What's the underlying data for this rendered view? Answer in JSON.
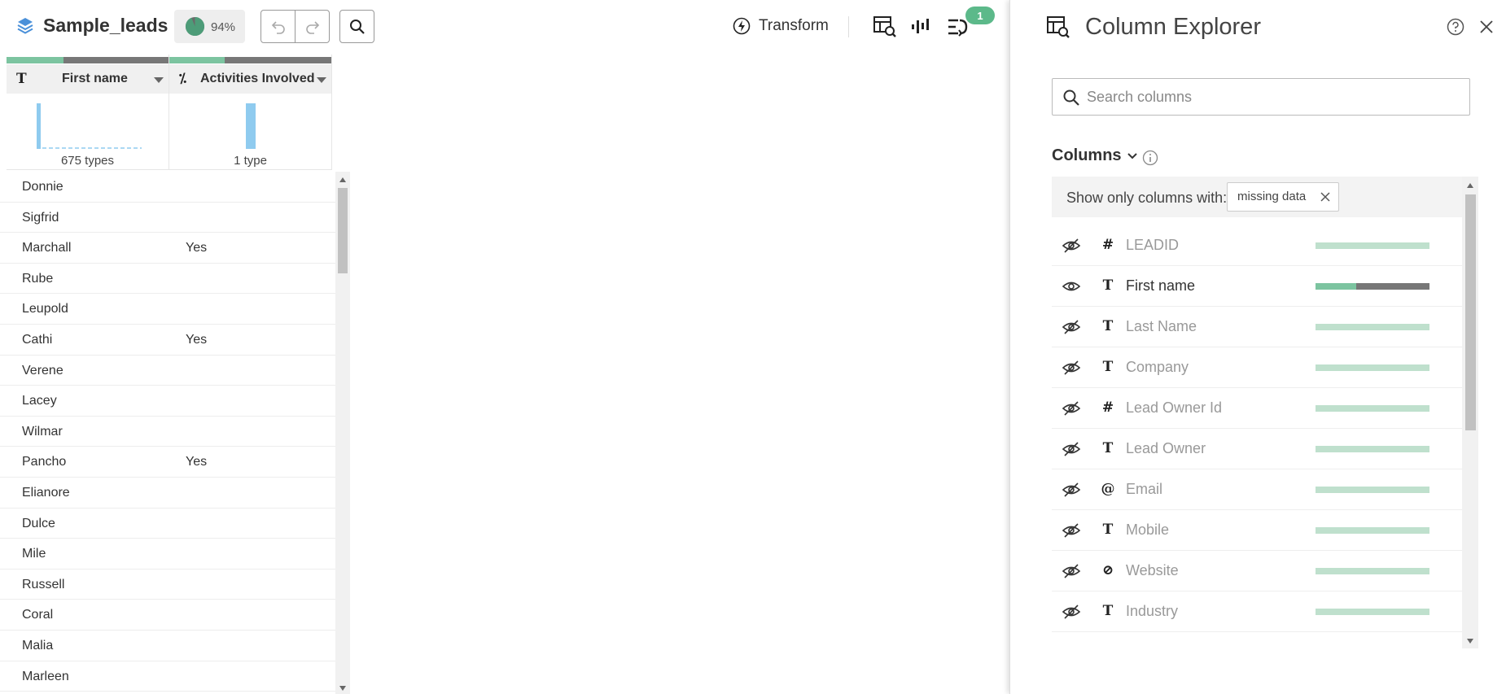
{
  "toolbar": {
    "dataset_name": "Sample_leads",
    "quality_percent": 94,
    "quality_label": "94%",
    "transform_label": "Transform",
    "notification_count": "1"
  },
  "grid": {
    "columns": [
      {
        "type_glyph": "T",
        "name": "First name",
        "types_summary": "675 types",
        "valid_fraction": 0.35,
        "missing_fraction": 0.65
      },
      {
        "type_glyph": "⁒",
        "name": "Activities Involved",
        "types_summary": "1 type",
        "valid_fraction": 0.34,
        "missing_fraction": 0.66
      }
    ],
    "rows": [
      [
        "Donnie",
        ""
      ],
      [
        "Sigfrid",
        ""
      ],
      [
        "Marchall",
        "Yes"
      ],
      [
        "Rube",
        ""
      ],
      [
        "Leupold",
        ""
      ],
      [
        "Cathi",
        "Yes"
      ],
      [
        "Verene",
        ""
      ],
      [
        "Lacey",
        ""
      ],
      [
        "Wilmar",
        ""
      ],
      [
        "Pancho",
        "Yes"
      ],
      [
        "Elianore",
        ""
      ],
      [
        "Dulce",
        ""
      ],
      [
        "Mile",
        ""
      ],
      [
        "Russell",
        ""
      ],
      [
        "Coral",
        ""
      ],
      [
        "Malia",
        ""
      ],
      [
        "Marleen",
        ""
      ]
    ]
  },
  "panel": {
    "title": "Column Explorer",
    "search_placeholder": "Search columns",
    "columns_heading": "Columns",
    "filter_label": "Show only columns with:",
    "filter_chip": "missing data",
    "columns": [
      {
        "type_glyph": "#",
        "name": "LEADID",
        "visible": false,
        "missing_fraction": 0
      },
      {
        "type_glyph": "T",
        "name": "First name",
        "visible": true,
        "missing_fraction": 0.64
      },
      {
        "type_glyph": "T",
        "name": "Last Name",
        "visible": false,
        "missing_fraction": 0
      },
      {
        "type_glyph": "T",
        "name": "Company",
        "visible": false,
        "missing_fraction": 0
      },
      {
        "type_glyph": "#",
        "name": "Lead Owner Id",
        "visible": false,
        "missing_fraction": 0
      },
      {
        "type_glyph": "T",
        "name": "Lead Owner",
        "visible": false,
        "missing_fraction": 0
      },
      {
        "type_glyph": "@",
        "name": "Email",
        "visible": false,
        "missing_fraction": 0
      },
      {
        "type_glyph": "T",
        "name": "Mobile",
        "visible": false,
        "missing_fraction": 0
      },
      {
        "type_glyph": "⊘",
        "name": "Website",
        "visible": false,
        "missing_fraction": 0
      },
      {
        "type_glyph": "T",
        "name": "Industry",
        "visible": false,
        "missing_fraction": 0
      }
    ]
  },
  "colors": {
    "valid": "#7cc4a0",
    "valid_faded": "#bfe0cd",
    "missing": "#777777",
    "histogram": "#8fcbef",
    "badge": "#5cb98a"
  }
}
